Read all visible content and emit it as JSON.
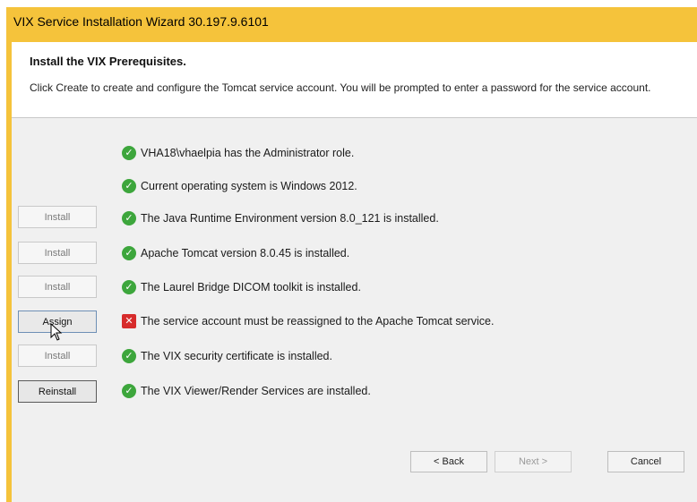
{
  "window": {
    "title": "VIX Service Installation Wizard 30.197.9.6101"
  },
  "header": {
    "heading": "Install the VIX Prerequisites.",
    "description": "Click Create to create and configure the Tomcat service account. You will be prompted to enter a password for the service account."
  },
  "rows": [
    {
      "button": "",
      "status": "ok",
      "text": "VHA18\\vhaelpia has the Administrator role."
    },
    {
      "button": "",
      "status": "ok",
      "text": "Current operating system is Windows 2012."
    },
    {
      "button": "Install",
      "status": "ok",
      "text": "The Java Runtime Environment version 8.0_121 is installed."
    },
    {
      "button": "Install",
      "status": "ok",
      "text": "Apache Tomcat version 8.0.45 is installed."
    },
    {
      "button": "Install",
      "status": "ok",
      "text": "The Laurel Bridge DICOM toolkit is installed."
    },
    {
      "button": "Assign",
      "status": "error",
      "text": "The service account must be reassigned to the Apache Tomcat service."
    },
    {
      "button": "Install",
      "status": "ok",
      "text": "The VIX security certificate is installed."
    },
    {
      "button": "Reinstall",
      "status": "ok",
      "text": "The VIX Viewer/Render Services are installed."
    }
  ],
  "footer": {
    "back_label": "< Back",
    "next_label": "Next >",
    "cancel_label": "Cancel"
  },
  "colors": {
    "titlebar": "#f5c33b",
    "ok": "#3da63c",
    "error": "#d72b2b"
  },
  "icons": {
    "ok": "check-circle-icon",
    "error": "error-x-icon",
    "cursor": "pointer-cursor-icon"
  }
}
